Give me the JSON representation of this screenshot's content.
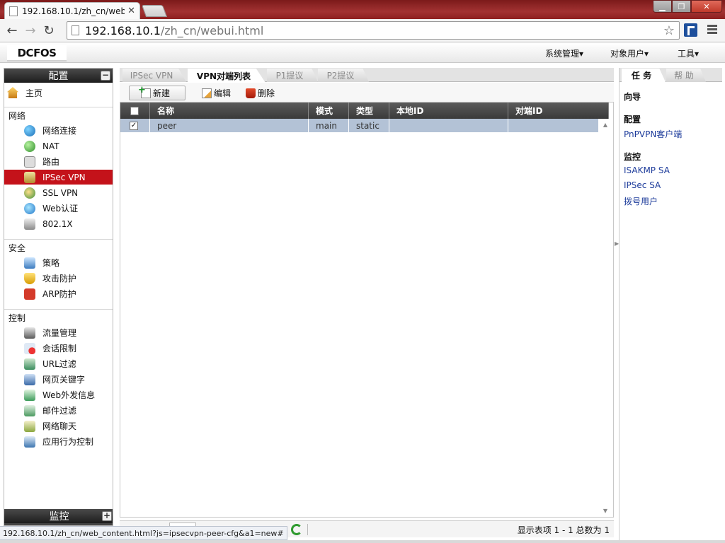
{
  "browser": {
    "tab_title": "192.168.10.1/zh_cn/web",
    "url_host": "192.168.10.1",
    "url_path": "/zh_cn/webui.html",
    "status_url": "192.168.10.1/zh_cn/web_content.html?js=ipsecvpn-peer-cfg&a1=new#"
  },
  "app": {
    "logo": "DCFOS",
    "top_menu": [
      {
        "label": "系统管理▾"
      },
      {
        "label": "对象用户▾"
      },
      {
        "label": "工具▾"
      }
    ]
  },
  "sidebar": {
    "title": "配置",
    "collapse_symbol": "−",
    "home": "主页",
    "groups": [
      {
        "title": "网络",
        "items": [
          "网络连接",
          "NAT",
          "路由",
          "IPSec VPN",
          "SSL VPN",
          "Web认证",
          "802.1X"
        ]
      },
      {
        "title": "安全",
        "items": [
          "策略",
          "攻击防护",
          "ARP防护"
        ]
      },
      {
        "title": "控制",
        "items": [
          "流量管理",
          "会话限制",
          "URL过滤",
          "网页关键字",
          "Web外发信息",
          "邮件过滤",
          "网络聊天",
          "应用行为控制"
        ]
      }
    ],
    "active_item": "IPSec VPN",
    "bottom_title": "监控",
    "expand_symbol": "+"
  },
  "content": {
    "tabs": [
      {
        "label": "IPSec VPN",
        "active": false
      },
      {
        "label": "VPN对端列表",
        "active": true
      },
      {
        "label": "P1提议",
        "active": false
      },
      {
        "label": "P2提议",
        "active": false
      }
    ],
    "actions": {
      "new": "新建",
      "edit": "编辑",
      "delete": "删除"
    },
    "table": {
      "columns": [
        "名称",
        "模式",
        "类型",
        "本地ID",
        "对端ID"
      ],
      "rows": [
        {
          "checked": true,
          "name": "peer",
          "mode": "main",
          "type": "static",
          "local_id": "",
          "peer_id": ""
        }
      ]
    },
    "status": "显示表项 1 - 1 总数为 1"
  },
  "right_panel": {
    "tabs": [
      {
        "label": "任 务",
        "active": true
      },
      {
        "label": "帮 助",
        "active": false
      }
    ],
    "sections": [
      {
        "title": "向导",
        "links": []
      },
      {
        "title": "配置",
        "links": [
          "PnPVPN客户端"
        ]
      },
      {
        "title": "监控",
        "links": [
          "ISAKMP SA",
          "IPSec SA",
          "拨号用户"
        ]
      }
    ]
  },
  "colors": {
    "active_nav": "#c4121a",
    "selected_row": "#b3c2d6",
    "link": "#1b3a9a",
    "title_bar": "#a23232"
  }
}
